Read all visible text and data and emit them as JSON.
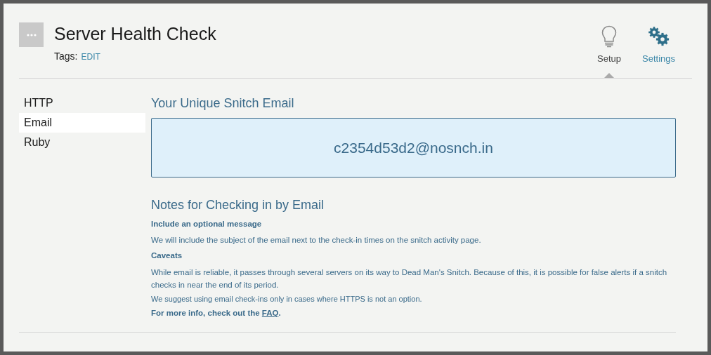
{
  "header": {
    "title": "Server Health Check",
    "tags_label": "Tags:",
    "tags_action": "EDIT"
  },
  "tabs": [
    {
      "label": "Setup",
      "kind": "bulb",
      "selected": true
    },
    {
      "label": "Settings",
      "kind": "gears",
      "selected": false
    }
  ],
  "sidebar": {
    "items": [
      {
        "label": "HTTP",
        "selected": false
      },
      {
        "label": "Email",
        "selected": true
      },
      {
        "label": "Ruby",
        "selected": false
      }
    ]
  },
  "email_section": {
    "title": "Your Unique Snitch Email",
    "address": "c2354d53d2@nosnch.in"
  },
  "notes": {
    "title": "Notes for Checking in by Email",
    "blocks": [
      {
        "kind": "heading",
        "text": "Include an optional message"
      },
      {
        "kind": "body",
        "text": "We will include the subject of the email next to the check-in times on the snitch activity page."
      },
      {
        "kind": "heading",
        "text": "Caveats"
      },
      {
        "kind": "body",
        "text": "While email is reliable, it passes through several servers on its way to Dead Man's Snitch. Because of this, it is possible for false alerts if a snitch checks in near the end of its period."
      },
      {
        "kind": "small",
        "text": "We suggest using email check-ins only in cases where HTTPS is not an option."
      }
    ],
    "more_info": {
      "prefix": "For more info, check out the",
      "link": "FAQ",
      "suffix": "."
    }
  }
}
